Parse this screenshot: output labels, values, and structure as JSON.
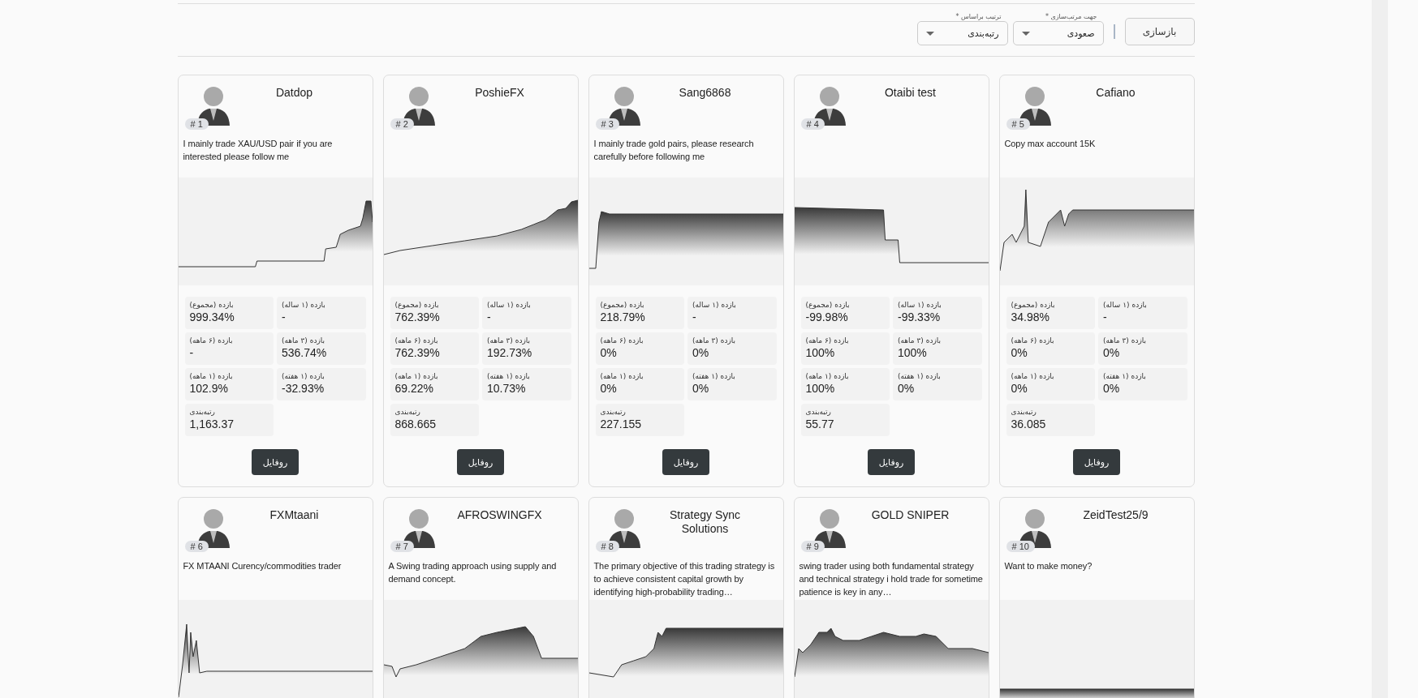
{
  "toolbar": {
    "rebuild_button": "بازسازی",
    "filters": [
      {
        "label": "جهت مرتب‌سازی *",
        "value": "صعودی"
      },
      {
        "label": "ترتیب براساس *",
        "value": "رتبه‌بندی"
      }
    ]
  },
  "cards": [
    {
      "name": "Cafiano",
      "rank": "# 5",
      "description": "Copy max account 15K",
      "stats": [
        {
          "label": "بازده (۱ ساله)",
          "value": "-"
        },
        {
          "label": "بازده (مجموع)",
          "value": "34.98%"
        },
        {
          "label": "بازده (۳ ماهه)",
          "value": "0%"
        },
        {
          "label": "بازده (۶ ماهه)",
          "value": "0%"
        },
        {
          "label": "بازده (۱ هفته)",
          "value": "0%"
        },
        {
          "label": "بازده (۱ ماهه)",
          "value": "0%"
        },
        {
          "label": "رتبه‌بندی",
          "value": "36.085",
          "kind": "rating"
        }
      ],
      "button": "روفایل"
    },
    {
      "name": "Otaibi test",
      "rank": "# 4",
      "stats": [
        {
          "label": "بازده (۱ ساله)",
          "value": "-99.33%"
        },
        {
          "label": "بازده (مجموع)",
          "value": "-99.98%"
        },
        {
          "label": "بازده (۳ ماهه)",
          "value": "100%"
        },
        {
          "label": "بازده (۶ ماهه)",
          "value": "100%"
        },
        {
          "label": "بازده (۱ هفته)",
          "value": "0%"
        },
        {
          "label": "بازده (۱ ماهه)",
          "value": "100%"
        },
        {
          "label": "رتبه‌بندی",
          "value": "55.77",
          "kind": "rating"
        }
      ],
      "button": "روفایل"
    },
    {
      "name": "Sang6868",
      "rank": "# 3",
      "description": "I mainly trade gold pairs, please research carefully before following me",
      "stats": [
        {
          "label": "بازده (۱ ساله)",
          "value": "-"
        },
        {
          "label": "بازده (مجموع)",
          "value": "218.79%"
        },
        {
          "label": "بازده (۳ ماهه)",
          "value": "0%"
        },
        {
          "label": "بازده (۶ ماهه)",
          "value": "0%"
        },
        {
          "label": "بازده (۱ هفته)",
          "value": "0%"
        },
        {
          "label": "بازده (۱ ماهه)",
          "value": "0%"
        },
        {
          "label": "رتبه‌بندی",
          "value": "227.155",
          "kind": "rating"
        }
      ],
      "button": "روفایل"
    },
    {
      "name": "PoshieFX",
      "rank": "# 2",
      "stats": [
        {
          "label": "بازده (۱ ساله)",
          "value": "-"
        },
        {
          "label": "بازده (مجموع)",
          "value": "762.39%"
        },
        {
          "label": "بازده (۳ ماهه)",
          "value": "192.73%"
        },
        {
          "label": "بازده (۶ ماهه)",
          "value": "762.39%"
        },
        {
          "label": "بازده (۱ هفته)",
          "value": "10.73%"
        },
        {
          "label": "بازده (۱ ماهه)",
          "value": "69.22%"
        },
        {
          "label": "رتبه‌بندی",
          "value": "868.665",
          "kind": "rating"
        }
      ],
      "button": "روفایل"
    },
    {
      "name": "Datdop",
      "rank": "# 1",
      "description": "I mainly trade XAU/USD pair if you are interested please follow me",
      "stats": [
        {
          "label": "بازده (۱ ساله)",
          "value": "-"
        },
        {
          "label": "بازده (مجموع)",
          "value": "999.34%"
        },
        {
          "label": "بازده (۳ ماهه)",
          "value": "536.74%"
        },
        {
          "label": "بازده (۶ ماهه)",
          "value": "-"
        },
        {
          "label": "بازده (۱ هفته)",
          "value": "-32.93%"
        },
        {
          "label": "بازده (۱ ماهه)",
          "value": "102.9%"
        },
        {
          "label": "رتبه‌بندی",
          "value": "1,163.37",
          "kind": "rating"
        }
      ],
      "button": "روفایل"
    },
    {
      "name": "ZeidTest25/9",
      "rank": "# 10",
      "description": "Want to make money?"
    },
    {
      "name": "GOLD SNIPER",
      "rank": "# 9",
      "description": "swing trader using both fundamental strategy and technical strategy i hold trade for sometime patience is key in any…"
    },
    {
      "name": "Strategy Sync Solutions",
      "rank": "# 8",
      "description": "The primary objective of this trading strategy is to achieve consistent capital growth by identifying high-probability trading…"
    },
    {
      "name": "AFROSWINGFX",
      "rank": "# 7",
      "description": "A Swing trading approach using supply and demand concept."
    },
    {
      "name": "FXMtaani",
      "rank": "# 6",
      "description": "FX MTAANI Curency/commodities trader"
    }
  ]
}
